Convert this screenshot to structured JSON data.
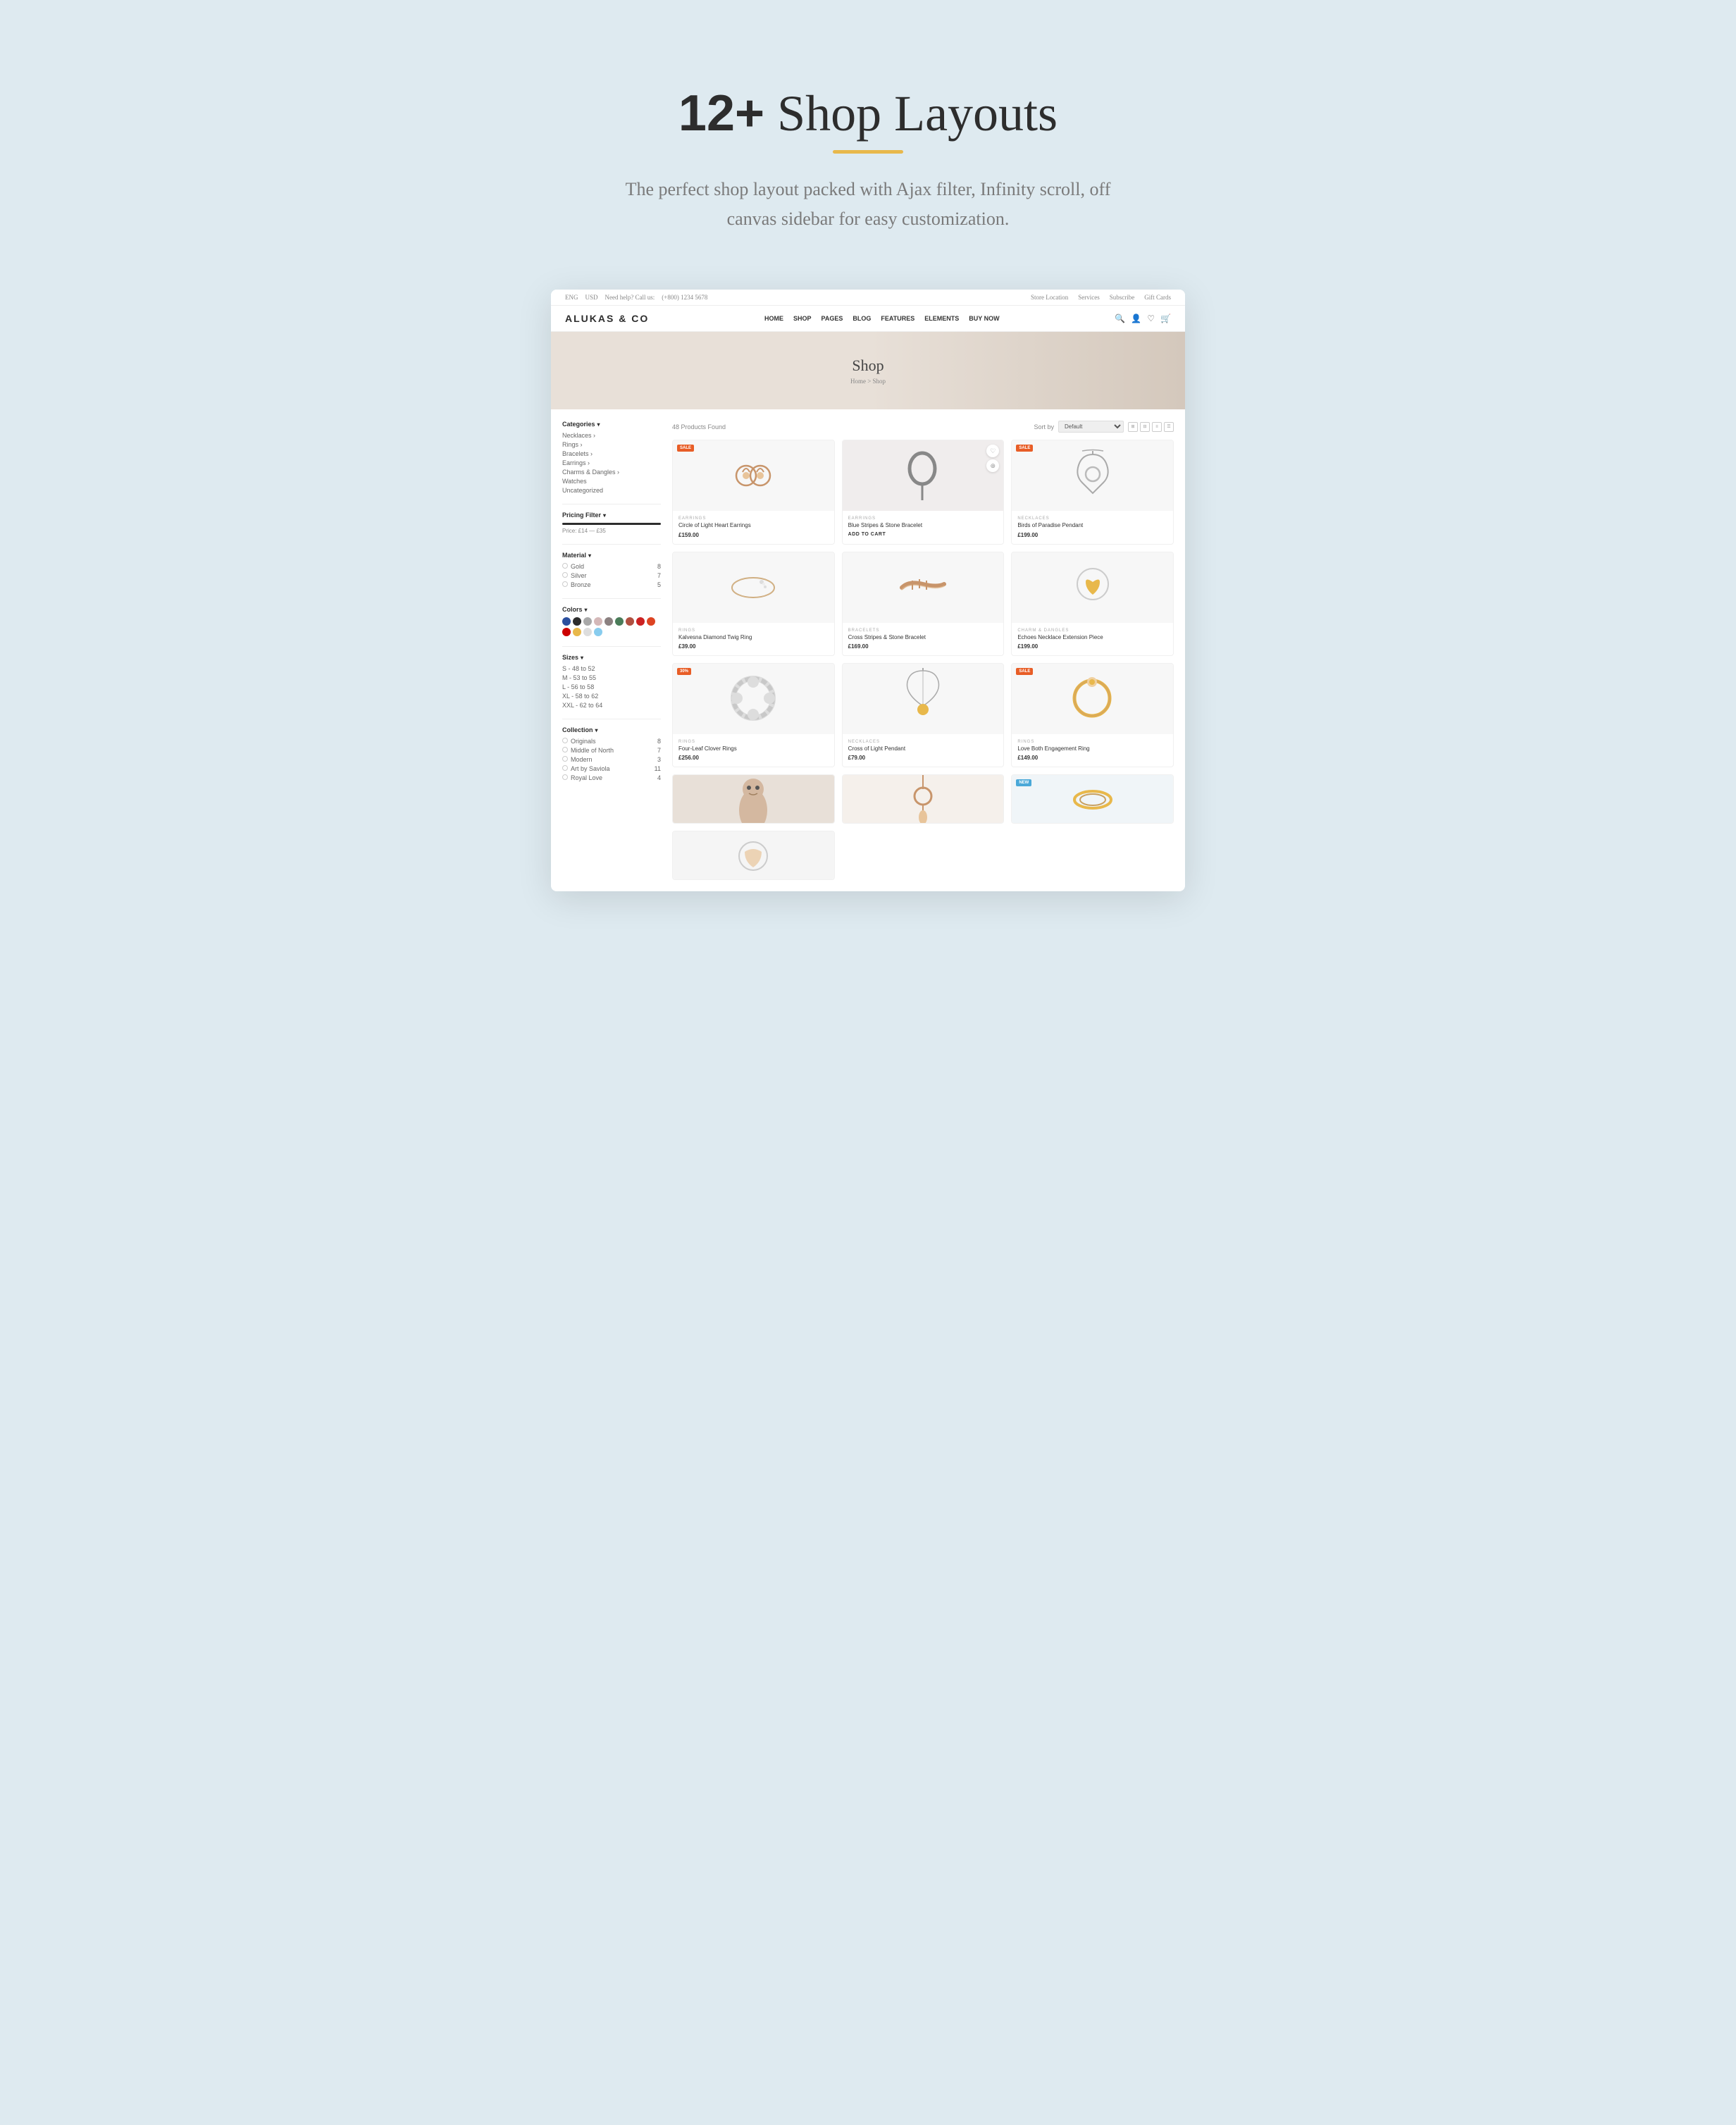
{
  "hero": {
    "title_bold": "12+",
    "title_rest": " Shop Layouts",
    "subtitle": "The perfect shop layout packed with Ajax filter, Infinity scroll, off canvas sidebar for easy customization.",
    "underline_color": "#e8b84b"
  },
  "topbar": {
    "lang": "ENG",
    "currency": "USD",
    "phone_label": "Need help? Call us:",
    "phone": "(+800) 1234 5678",
    "right_links": [
      "Store Location",
      "Services",
      "Subscribe",
      "Gift Cards"
    ]
  },
  "nav": {
    "logo": "ALUKAS & CO",
    "links": [
      "HOME",
      "SHOP",
      "PAGES",
      "BLOG",
      "FEATURES",
      "ELEMENTS",
      "BUY NOW"
    ]
  },
  "banner": {
    "title": "Shop",
    "breadcrumb": "Home > Shop"
  },
  "sidebar": {
    "categories_label": "Categories",
    "categories": [
      {
        "label": "Necklaces",
        "has_arrow": true
      },
      {
        "label": "Rings",
        "has_arrow": true
      },
      {
        "label": "Bracelets",
        "has_arrow": true
      },
      {
        "label": "Earrings",
        "has_arrow": true
      },
      {
        "label": "Charms & Dangles",
        "has_arrow": true
      },
      {
        "label": "Watches"
      },
      {
        "label": "Uncategorized"
      }
    ],
    "pricing_filter_label": "Pricing Filter",
    "price_range": "Price: £14 — £35",
    "material_label": "Material",
    "materials": [
      {
        "name": "Gold",
        "count": 8
      },
      {
        "name": "Silver",
        "count": 7
      },
      {
        "name": "Bronze",
        "count": 5
      }
    ],
    "colors_label": "Colors",
    "colors": [
      "#2b4f9e",
      "#2d2d2d",
      "#a8a8a8",
      "#d4b8b8",
      "#8b8080",
      "#4a7c59",
      "#b05040",
      "#cc2222",
      "#dd4422",
      "#cc0000",
      "#e8b84b",
      "#dddddd",
      "#88ccee"
    ],
    "sizes_label": "Sizes",
    "sizes": [
      "S - 48 to 52",
      "M - 53 to 55",
      "L - 56 to 58",
      "XL - 58 to 62",
      "XXL - 62 to 64"
    ],
    "collection_label": "Collection",
    "collections": [
      {
        "name": "Originals",
        "count": 8
      },
      {
        "name": "Middle of North",
        "count": 7
      },
      {
        "name": "Modern",
        "count": 3
      },
      {
        "name": "Art by Saviola",
        "count": 11
      },
      {
        "name": "Royal Love",
        "count": 4
      }
    ]
  },
  "product_grid": {
    "products_found": "48 Products Found",
    "sort_label": "Sort by",
    "sort_default": "Default",
    "products": [
      {
        "badge": "SALE",
        "badge_type": "sale",
        "category": "EARRINGS",
        "name": "Circle of Light Heart Earrings",
        "price": "£159.00",
        "action": null,
        "img_type": "earring-gold"
      },
      {
        "badge": null,
        "category": "EARRINGS",
        "name": "Blue Stripes & Stone Bracelet",
        "price": null,
        "action": "ADD TO CART",
        "img_type": "earring-hoop",
        "wishlist": true,
        "zoom": true
      },
      {
        "badge": "SALE",
        "badge_type": "sale",
        "category": "NECKLACES",
        "name": "Birds of Paradise Pendant",
        "price": "£199.00",
        "action": null,
        "img_type": "necklace-pendant"
      },
      {
        "badge": null,
        "category": "RINGS",
        "name": "Kalvesna Diamond Twig Ring",
        "price": "£39.00",
        "action": null,
        "img_type": "ring-thin"
      },
      {
        "badge": null,
        "category": "BRACELETS",
        "name": "Cross Stripes & Stone Bracelet",
        "price": "£169.00",
        "action": null,
        "img_type": "bracelet-cross"
      },
      {
        "badge": null,
        "category": "CHARM & DANGLES",
        "name": "Echoes Necklace Extension Piece",
        "price": "£199.00",
        "action": null,
        "img_type": "charm-heart"
      },
      {
        "badge": "30%",
        "badge_type": "percent",
        "category": "RINGS",
        "name": "Four-Leaf Clover Rings",
        "price": "£256.00",
        "action": null,
        "img_type": "ring-clover"
      },
      {
        "badge": null,
        "category": "NECKLACES",
        "name": "Cross of Light Pendant",
        "price": "£79.00",
        "action": null,
        "img_type": "necklace-cross"
      },
      {
        "badge": "SALE",
        "badge_type": "sale",
        "category": "RINGS",
        "name": "Love Both Engagement Ring",
        "price": "£149.00",
        "action": null,
        "img_type": "ring-engagement"
      },
      {
        "badge": null,
        "category": "",
        "name": "",
        "price": "",
        "action": null,
        "img_type": "partial-face",
        "partial": true
      },
      {
        "badge": null,
        "category": "",
        "name": "",
        "price": "",
        "action": null,
        "img_type": "partial-earring",
        "partial": true
      },
      {
        "badge": "NEW",
        "badge_type": "new",
        "category": "",
        "name": "",
        "price": "",
        "action": null,
        "img_type": "partial-ring",
        "partial": true
      },
      {
        "badge": null,
        "category": "",
        "name": "",
        "price": "",
        "action": null,
        "img_type": "partial-item",
        "partial": true
      }
    ]
  }
}
